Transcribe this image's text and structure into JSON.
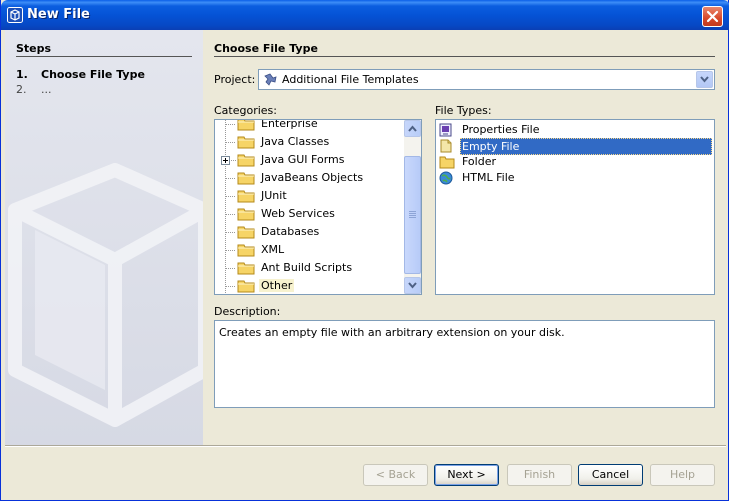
{
  "window": {
    "title": "New File"
  },
  "steps": {
    "title": "Steps",
    "items": [
      {
        "num": "1.",
        "label": "Choose File Type"
      },
      {
        "num": "2.",
        "label": "..."
      }
    ]
  },
  "main": {
    "title": "Choose File Type",
    "project_label": "Project:",
    "project_value": "Additional File Templates",
    "categories_label": "Categories:",
    "categories": [
      "Enterprise",
      "Java Classes",
      "Java GUI Forms",
      "JavaBeans Objects",
      "JUnit",
      "Web Services",
      "Databases",
      "XML",
      "Ant Build Scripts",
      "Other"
    ],
    "file_types_label": "File Types:",
    "file_types": [
      {
        "label": "Properties File",
        "icon": "properties-file-icon"
      },
      {
        "label": "Empty File",
        "icon": "empty-file-icon"
      },
      {
        "label": "Folder",
        "icon": "folder-icon"
      },
      {
        "label": "HTML File",
        "icon": "html-file-icon"
      }
    ],
    "description_label": "Description:",
    "description_text": "Creates an empty file with an arbitrary extension on your disk."
  },
  "buttons": {
    "back": "< Back",
    "next": "Next >",
    "finish": "Finish",
    "cancel": "Cancel",
    "help": "Help"
  },
  "colors": {
    "titlebar": "#0553d6",
    "selection": "#316ac5",
    "dialog_bg": "#ece9d8"
  }
}
